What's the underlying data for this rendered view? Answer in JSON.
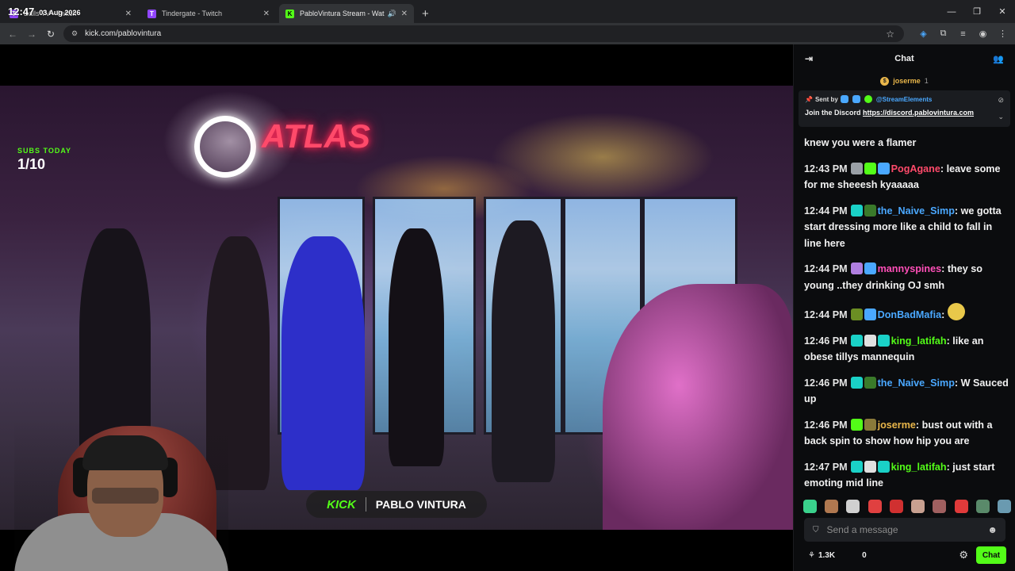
{
  "clock": {
    "time": "12:47",
    "date": "03 Aug 2026"
  },
  "tabs": [
    {
      "title": "Balls TV - Twitch",
      "favicon": "T",
      "color": "#9146ff"
    },
    {
      "title": "Tindergate - Twitch",
      "favicon": "T",
      "color": "#9146ff"
    },
    {
      "title": "PabloVintura Stream - Wat",
      "favicon": "K",
      "color": "#53fc18"
    }
  ],
  "addressbar": {
    "url": "kick.com/pablovintura"
  },
  "video": {
    "subs_label": "SUBS TODAY",
    "subs_count": "1/10",
    "banner_brand": "KICK",
    "banner_name": "PABLO VINTURA",
    "store_sign": "ATLAS"
  },
  "chat": {
    "title": "Chat",
    "top_gifter": {
      "name": "joserme",
      "count": "1"
    },
    "pinned": {
      "sent_by": "Sent by",
      "author": "@StreamElements",
      "message_prefix": "Join the Discord",
      "link": "https://discord.pablovintura.com"
    },
    "messages": [
      {
        "time": "",
        "user": "",
        "color": "#ffffff",
        "badges": [],
        "text": "knew you were a flamer"
      },
      {
        "time": "12:43 PM",
        "user": "PogAgane",
        "color": "#ff4a6a",
        "badges": [
          "#9aa0a6",
          "#53fc18",
          "#4aa8ff"
        ],
        "text": "leave some for me sheeesh kyaaaaa"
      },
      {
        "time": "12:44 PM",
        "user": "the_Naive_Simp",
        "color": "#4aa8ff",
        "badges": [
          "#1ad1c7",
          "#3a7a2a"
        ],
        "text": "we gotta start dressing more like a child to fall in line here"
      },
      {
        "time": "12:44 PM",
        "user": "mannyspines",
        "color": "#ff4fb8",
        "badges": [
          "#b07fe0",
          "#4aa8ff"
        ],
        "text": "they so young ..they drinking OJ smh"
      },
      {
        "time": "12:44 PM",
        "user": "DonBadMafia",
        "color": "#4aa8ff",
        "badges": [
          "#6b8e23",
          "#4aa8ff"
        ],
        "text": ""
      },
      {
        "time": "12:46 PM",
        "user": "king_latifah",
        "color": "#53fc18",
        "badges": [
          "#1ad1c7",
          "#e0e0e0",
          "#1ad1c7"
        ],
        "text": "like an obese tillys mannequin"
      },
      {
        "time": "12:46 PM",
        "user": "the_Naive_Simp",
        "color": "#4aa8ff",
        "badges": [
          "#1ad1c7",
          "#3a7a2a"
        ],
        "text": "W Sauced up"
      },
      {
        "time": "12:46 PM",
        "user": "joserme",
        "color": "#e9b64a",
        "badges": [
          "#53fc18",
          "#8a7a3a"
        ],
        "text": "bust out with a back spin to show how hip you are"
      },
      {
        "time": "12:47 PM",
        "user": "king_latifah",
        "color": "#53fc18",
        "badges": [
          "#1ad1c7",
          "#e0e0e0",
          "#1ad1c7"
        ],
        "text": "just start emoting mid line"
      }
    ],
    "emotes": [
      "#3ad18c",
      "#b07850",
      "#d0d0d0",
      "#e04040",
      "#d03030",
      "#c8a090",
      "#a06060",
      "#e03a3a",
      "#5a8a6a",
      "#6a9ab0"
    ],
    "send_placeholder": "Send a message",
    "viewers": "1.3K",
    "points": "0",
    "chat_button": "Chat"
  }
}
